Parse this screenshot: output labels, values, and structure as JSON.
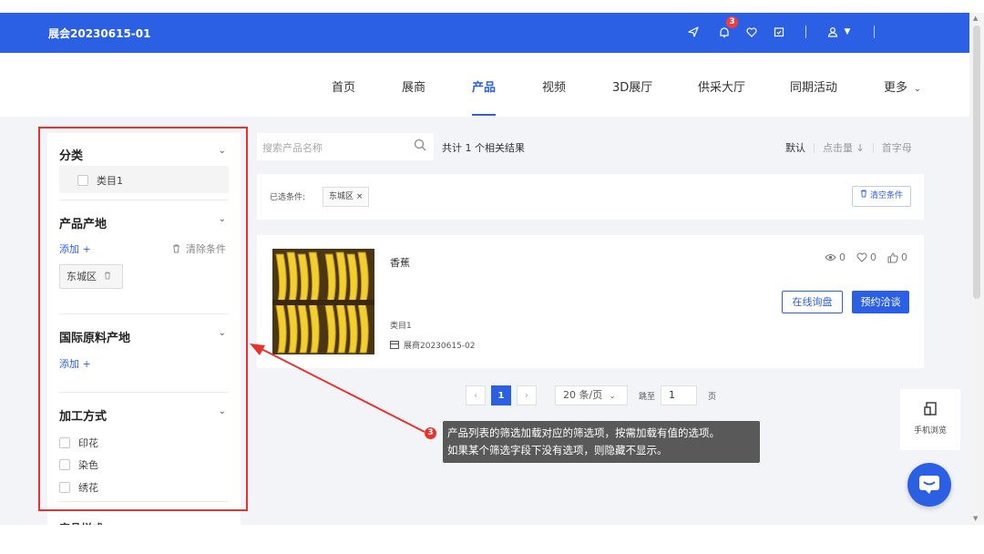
{
  "topbar": {
    "title": "展会20230615-01",
    "notification_count": "3"
  },
  "nav": {
    "items": [
      {
        "label": "首页"
      },
      {
        "label": "展商"
      },
      {
        "label": "产品"
      },
      {
        "label": "视频"
      },
      {
        "label": "3D展厅"
      },
      {
        "label": "供采大厅"
      },
      {
        "label": "同期活动"
      },
      {
        "label": "更多"
      }
    ],
    "active": "产品"
  },
  "sidebar": {
    "category": {
      "title": "分类",
      "options": [
        "类目1"
      ]
    },
    "origin": {
      "title": "产品产地",
      "add_label": "添加 +",
      "clear_label": "清除条件",
      "selected_tag": "东城区"
    },
    "intl_origin": {
      "title": "国际原料产地",
      "add_label": "添加 +"
    },
    "processing": {
      "title": "加工方式",
      "options": [
        "印花",
        "染色",
        "绣花"
      ]
    },
    "next_section_title": "产品样式"
  },
  "search": {
    "placeholder": "搜索产品名称"
  },
  "result_count": "共计 1 个相关结果",
  "sort": {
    "default": "默认",
    "clicks": "点击量 ↓",
    "initial": "首字母"
  },
  "filters": {
    "label": "已选条件:",
    "chip": "东城区 ×",
    "clear": "清空条件"
  },
  "product": {
    "name": "香蕉",
    "category": "类目1",
    "exhibitor": "展商20230615-02",
    "views": "0",
    "likes": "0",
    "thumbs": "0",
    "inquiry_button": "在线询盘",
    "negotiate_button": "预约洽谈"
  },
  "pagination": {
    "current_page": "1",
    "page_size": "20 条/页",
    "jump_label": "跳至",
    "jump_value": "1",
    "page_unit": "页"
  },
  "tooltip": {
    "badge": "3",
    "line1": "产品列表的筛选加载对应的筛选项，按需加载有值的选项。",
    "line2": "如果某个筛选字段下没有选项，则隐藏不显示。"
  },
  "mobile_view": {
    "label": "手机浏览"
  },
  "colors": {
    "primary": "#2c60e4",
    "annotation_red": "#e8322e",
    "tooltip_bg": "#595959"
  }
}
